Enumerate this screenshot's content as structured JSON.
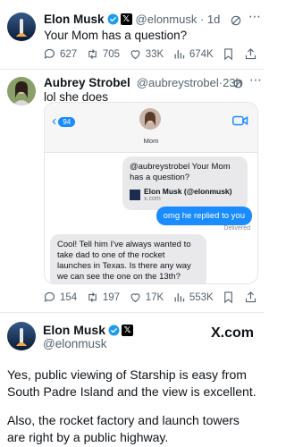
{
  "tweet1": {
    "name": "Elon Musk",
    "handle": "@elonmusk",
    "time": "1d",
    "text": "Your Mom has a question?",
    "replies": "627",
    "retweets": "705",
    "likes": "33K",
    "views": "674K"
  },
  "tweet2": {
    "name": "Aubrey Strobel",
    "handle": "@aubreystrobel",
    "time": "23h",
    "text": "lol she does",
    "replies": "154",
    "retweets": "197",
    "likes": "17K",
    "views": "553K"
  },
  "imessage": {
    "back_count": "94",
    "contact_name": "Mom",
    "msg1": "@aubreystrobel Your Mom has a question?",
    "link_title": "Elon Musk (@elonmusk)",
    "link_domain": "x.com",
    "msg2": "omg he replied to you",
    "delivered": "Delivered",
    "msg3": "Cool! Tell him I've always wanted to take dad to one of the rocket launches in Texas. Is there any way we can see the one on the 13th?"
  },
  "card": {
    "name": "Elon Musk",
    "handle": "@elonmusk",
    "brand": "X.com",
    "para1": "Yes, public viewing of Starship is easy from South Padre Island and the view is excellent.",
    "para2": "Also, the rocket factory and launch towers are right by a public highway."
  },
  "colors": {
    "accent": "#1d9bf0",
    "imessage_blue": "#1a8cff",
    "muted": "#536471"
  }
}
